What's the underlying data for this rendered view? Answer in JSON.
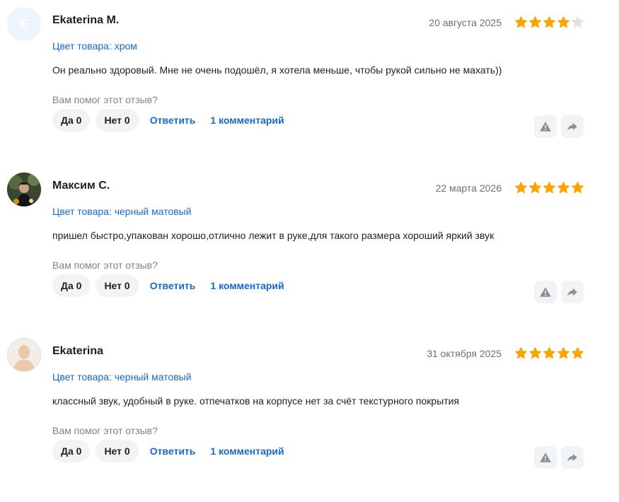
{
  "reviews": [
    {
      "avatar_letter": "E",
      "avatar_type": "letter",
      "author": "Ekaterina M.",
      "date": "20 августа 2025",
      "rating": 4,
      "variant": "Цвет товара: хром",
      "text": "Он реально здоровый. Мне не очень подошёл, я хотела меньше, чтобы рукой сильно не махать))",
      "helpful_question": "Вам помог этот отзыв?",
      "yes_label": "Да 0",
      "no_label": "Нет 0",
      "reply_label": "Ответить",
      "comments_label": "1 комментарий"
    },
    {
      "avatar_type": "photo",
      "author": "Максим С.",
      "date": "22 марта 2026",
      "rating": 5,
      "variant": "Цвет товара: черный матовый",
      "text": "пришел быстро,упакован хорошо,отлично лежит в руке,для такого размера хороший яркий звук",
      "helpful_question": "Вам помог этот отзыв?",
      "yes_label": "Да 0",
      "no_label": "Нет 0",
      "reply_label": "Ответить",
      "comments_label": "1 комментарий"
    },
    {
      "avatar_type": "default",
      "author": "Ekaterina",
      "date": "31 октября 2025",
      "rating": 5,
      "variant": "Цвет товара: черный матовый",
      "text": "классный звук, удобный в руке. отпечатков на корпусе нет за счёт текстурного покрытия",
      "helpful_question": "Вам помог этот отзыв?",
      "yes_label": "Да 0",
      "no_label": "Нет 0",
      "reply_label": "Ответить",
      "comments_label": "1 комментарий"
    }
  ],
  "colors": {
    "star_filled": "#f9a400",
    "star_empty": "#dfe1e5",
    "link": "#1668cc",
    "button_bg": "#f2f3f5"
  },
  "icons": {
    "report": "warning-triangle-icon",
    "share": "share-arrow-icon"
  }
}
